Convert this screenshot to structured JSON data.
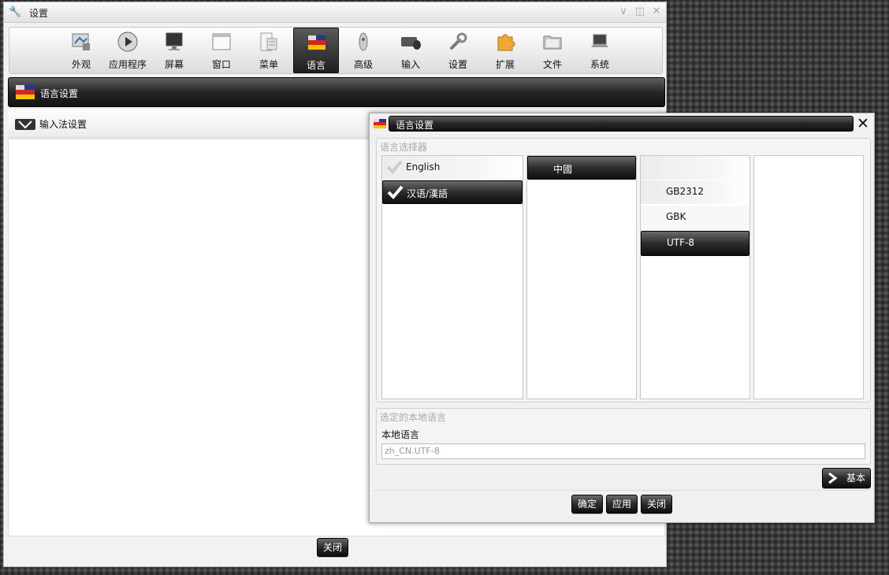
{
  "main_window": {
    "title": "设置",
    "toolbar": [
      {
        "label": "外观",
        "icon": "appearance-icon"
      },
      {
        "label": "应用程序",
        "icon": "play-icon"
      },
      {
        "label": "屏幕",
        "icon": "monitor-icon"
      },
      {
        "label": "窗口",
        "icon": "window-icon"
      },
      {
        "label": "菜单",
        "icon": "menu-icon"
      },
      {
        "label": "语言",
        "icon": "flag-icon",
        "active": true
      },
      {
        "label": "高级",
        "icon": "rocket-icon"
      },
      {
        "label": "输入",
        "icon": "keyboard-mouse-icon"
      },
      {
        "label": "设置",
        "icon": "wrench-icon"
      },
      {
        "label": "扩展",
        "icon": "puzzle-icon"
      },
      {
        "label": "文件",
        "icon": "folder-icon"
      },
      {
        "label": "系统",
        "icon": "laptop-icon"
      }
    ],
    "section_title": "语言设置",
    "subsection_title": "输入法设置",
    "close_label": "关闭"
  },
  "dialog": {
    "title": "语言设置",
    "selector_group_title": "语言选择器",
    "languages": [
      {
        "label": "English",
        "selected": false
      },
      {
        "label": "汉语/漢語",
        "selected": true
      }
    ],
    "regions": [
      {
        "label": "中國",
        "selected": true
      }
    ],
    "encodings": [
      {
        "label": "",
        "selected": false
      },
      {
        "label": "GB2312",
        "selected": false
      },
      {
        "label": "GBK",
        "selected": false
      },
      {
        "label": "UTF-8",
        "selected": true
      }
    ],
    "local_group_title": "选定的本地语言",
    "local_label": "本地语言",
    "local_value": "zh_CN.UTF-8",
    "basic_button": "基本",
    "ok_button": "确定",
    "apply_button": "应用",
    "close_button": "关闭"
  }
}
